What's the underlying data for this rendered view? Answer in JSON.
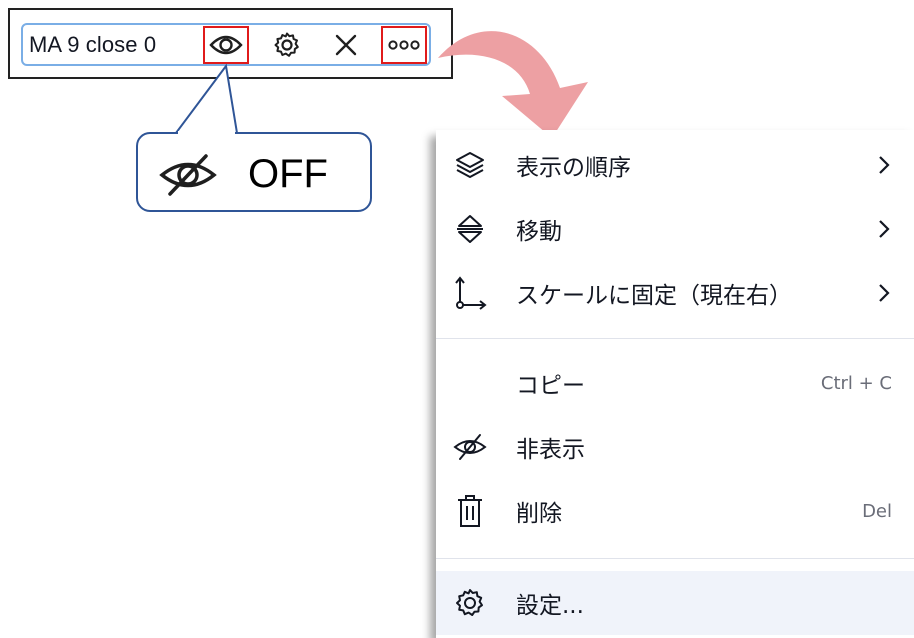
{
  "legend": {
    "label": "MA 9 close 0",
    "eye_icon": "eye-icon",
    "settings_icon": "gear-icon",
    "close_icon": "close-icon",
    "more_icon": "more-dots-icon",
    "highlight_color": "#e01b1b",
    "border_color": "#7aaee6"
  },
  "callout": {
    "icon": "eye-off-icon",
    "text": "OFF",
    "border_color": "#2f5597"
  },
  "arrow": {
    "color": "#eda0a3"
  },
  "menu": {
    "items": [
      {
        "label": "表示の順序",
        "icon": "layers-icon",
        "submenu": true
      },
      {
        "label": "移動",
        "icon": "move-vertical-icon",
        "submenu": true
      },
      {
        "label": "スケールに固定（現在右）",
        "icon": "axis-pin-icon",
        "submenu": true
      },
      {
        "label": "コピー",
        "shortcut": "Ctrl + C"
      },
      {
        "label": "非表示",
        "icon": "eye-off-icon"
      },
      {
        "label": "削除",
        "icon": "trash-icon",
        "shortcut": "Del"
      },
      {
        "label": "設定...",
        "icon": "gear-icon",
        "highlighted": true
      }
    ]
  }
}
